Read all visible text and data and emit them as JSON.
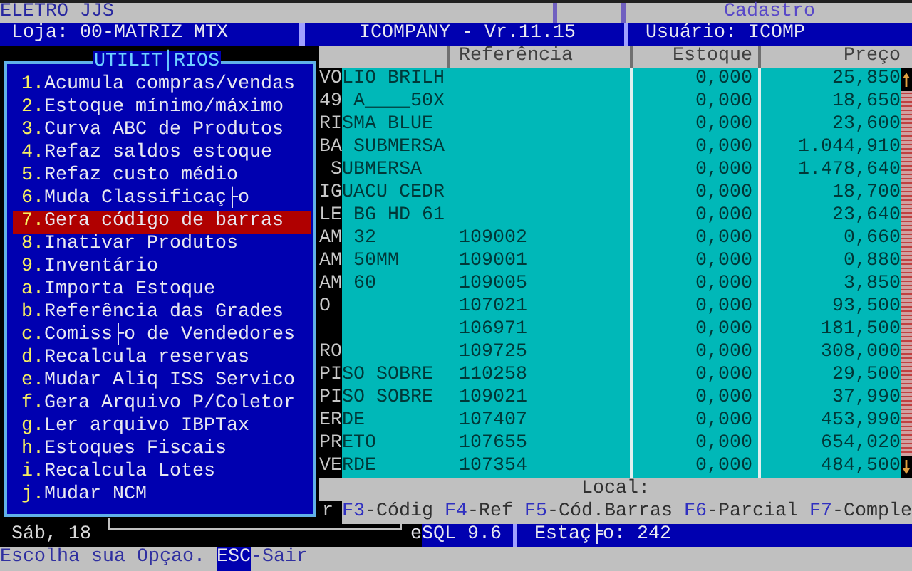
{
  "top_bar": {
    "company": "ELETRO JJS",
    "module": "Cadastro"
  },
  "info_bar": {
    "store": "Loja: 00-MATRIZ MTX",
    "product": "ICOMPANY - Vr.11.15",
    "user": "Usuário: ICOMP"
  },
  "menu": {
    "title": "UTILIT│RIOS",
    "items": [
      {
        "key": "1.",
        "label": "Acumula compras/vendas",
        "selected": false
      },
      {
        "key": "2.",
        "label": "Estoque mínimo/máximo",
        "selected": false
      },
      {
        "key": "3.",
        "label": "Curva ABC de Produtos",
        "selected": false
      },
      {
        "key": "4.",
        "label": "Refaz saldos estoque",
        "selected": false
      },
      {
        "key": "5.",
        "label": "Refaz custo médio",
        "selected": false
      },
      {
        "key": "6.",
        "label": "Muda Classificaç├o",
        "selected": false
      },
      {
        "key": "7.",
        "label": "Gera código de barras",
        "selected": true
      },
      {
        "key": "8.",
        "label": "Inativar Produtos",
        "selected": false
      },
      {
        "key": "9.",
        "label": "Inventário",
        "selected": false
      },
      {
        "key": "a.",
        "label": "Importa Estoque",
        "selected": false
      },
      {
        "key": "b.",
        "label": "Referência das Grades",
        "selected": false
      },
      {
        "key": "c.",
        "label": "Comiss├o de Vendedores",
        "selected": false
      },
      {
        "key": "d.",
        "label": "Recalcula reservas",
        "selected": false
      },
      {
        "key": "e.",
        "label": "Mudar Aliq ISS Servico",
        "selected": false
      },
      {
        "key": "f.",
        "label": "Gera Arquivo P/Coletor",
        "selected": false
      },
      {
        "key": "g.",
        "label": "Ler arquivo IBPTax",
        "selected": false
      },
      {
        "key": "h.",
        "label": "Estoques Fiscais",
        "selected": false
      },
      {
        "key": "i.",
        "label": "Recalcula Lotes",
        "selected": false
      },
      {
        "key": "j.",
        "label": "Mudar NCM",
        "selected": false
      }
    ]
  },
  "table": {
    "columns": [
      "Referência",
      "Estoque",
      "Preço"
    ],
    "rows": [
      {
        "description": "VOLIO BRILH",
        "reference": "",
        "stock": "0,000",
        "price": "25,850"
      },
      {
        "description": "49 A____50X",
        "reference": "",
        "stock": "0,000",
        "price": "18,650"
      },
      {
        "description": "RISMA BLUE",
        "reference": "",
        "stock": "0,000",
        "price": "23,600"
      },
      {
        "description": "BA SUBMERSA",
        "reference": "",
        "stock": "0,000",
        "price": "1.044,910"
      },
      {
        "description": " SUBMERSA",
        "reference": "",
        "stock": "0,000",
        "price": "1.478,640"
      },
      {
        "description": "IGUACU CEDR",
        "reference": "",
        "stock": "0,000",
        "price": "18,700"
      },
      {
        "description": "LE BG HD 61",
        "reference": "",
        "stock": "0,000",
        "price": "23,640"
      },
      {
        "description": "AM 32",
        "reference": "109002",
        "stock": "0,000",
        "price": "0,660"
      },
      {
        "description": "AM 50MM",
        "reference": "109001",
        "stock": "0,000",
        "price": "0,880"
      },
      {
        "description": "AM 60",
        "reference": "109005",
        "stock": "0,000",
        "price": "3,850"
      },
      {
        "description": "O",
        "reference": "107021",
        "stock": "0,000",
        "price": "93,500"
      },
      {
        "description": "",
        "reference": "106971",
        "stock": "0,000",
        "price": "181,500"
      },
      {
        "description": "RO",
        "reference": "109725",
        "stock": "0,000",
        "price": "308,000"
      },
      {
        "description": "PISO SOBRE",
        "reference": "110258",
        "stock": "0,000",
        "price": "29,500"
      },
      {
        "description": "PISO SOBRE",
        "reference": "109021",
        "stock": "0,000",
        "price": "37,990"
      },
      {
        "description": "ERDE",
        "reference": "107407",
        "stock": "0,000",
        "price": "453,990"
      },
      {
        "description": "PRETO",
        "reference": "107655",
        "stock": "0,000",
        "price": "654,020"
      },
      {
        "description": "VERDE",
        "reference": "107354",
        "stock": "0,000",
        "price": "484,500"
      }
    ]
  },
  "local_label": "Local:",
  "key_fragment": "r",
  "function_keys": [
    {
      "key": "F3",
      "label": "-Códig"
    },
    {
      "key": "F4",
      "label": "-Ref"
    },
    {
      "key": "F5",
      "label": "-Cód.Barras"
    },
    {
      "key": "F6",
      "label": "-Parcial"
    },
    {
      "key": "F7",
      "label": "-Comple"
    }
  ],
  "status_bar": {
    "date": "Sáb, 18",
    "database": "eSQL 9.6",
    "station": "Estaç╞o: 242"
  },
  "prompt": {
    "text": "Escolha sua Opçao.",
    "key": "ESC",
    "action": "-Sair"
  }
}
